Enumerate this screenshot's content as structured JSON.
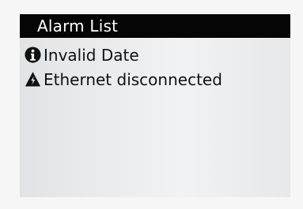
{
  "alarm_panel": {
    "title": "Alarm List",
    "items": [
      {
        "label": "Invalid Date",
        "icon": "info-icon"
      },
      {
        "label": "Ethernet disconnected",
        "icon": "warning-lightning-icon"
      }
    ]
  },
  "colors": {
    "header_background": "#050505",
    "header_text": "#ffffff",
    "screen_background": "#eaebed",
    "item_text": "#111111"
  }
}
